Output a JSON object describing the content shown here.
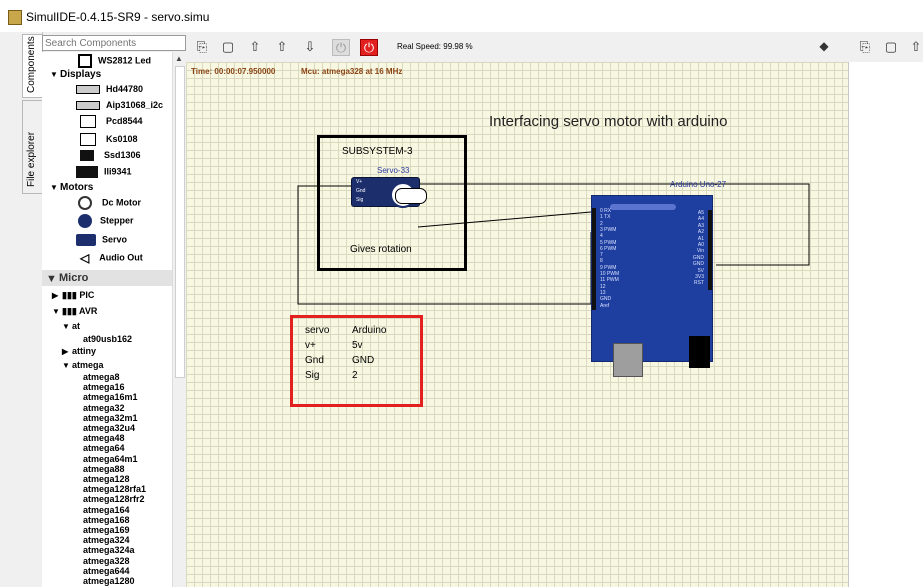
{
  "window": {
    "title": "SimulIDE-0.4.15-SR9  -  servo.simu"
  },
  "side_tabs": [
    "Components",
    "File explorer"
  ],
  "search": {
    "placeholder": "Search Components"
  },
  "tree": {
    "top_item": "WS2812 Led",
    "displays": {
      "label": "Displays",
      "items": [
        "Hd44780",
        "Aip31068_i2c",
        "Pcd8544",
        "Ks0108",
        "Ssd1306",
        "Ili9341"
      ]
    },
    "motors": {
      "label": "Motors",
      "items": [
        "Dc Motor",
        "Stepper",
        "Servo",
        "Audio Out"
      ]
    },
    "micro": {
      "label": "Micro",
      "pic": "PIC",
      "avr": "AVR",
      "at": "at",
      "at90": "at90usb162",
      "attiny": "attiny",
      "atmega": "atmega",
      "chips": [
        "atmega8",
        "atmega16",
        "atmega16m1",
        "atmega32",
        "atmega32m1",
        "atmega32u4",
        "atmega48",
        "atmega64",
        "atmega64m1",
        "atmega88",
        "atmega128",
        "atmega128rfa1",
        "atmega128rfr2",
        "atmega164",
        "atmega168",
        "atmega169",
        "atmega324",
        "atmega324a",
        "atmega328",
        "atmega644",
        "atmega1280"
      ]
    }
  },
  "toolbar": {
    "real_speed": "Real Speed: 99.98 %",
    "icons": [
      "new-circuit-icon",
      "new-file-icon",
      "open-icon",
      "save-icon",
      "save-as-icon",
      "power-off-icon",
      "power-on-icon"
    ]
  },
  "status": {
    "time": "Time: 00:00:07.950000",
    "mcu": "Mcu: atmega328 at 16 MHz"
  },
  "diagram": {
    "heading": "Interfacing  servo motor with arduino",
    "subsystem": "SUBSYSTEM-3",
    "servo_label": "Servo-33",
    "rotation": "Gives rotation",
    "arduino_label": "Arduino Uno-27",
    "servo_pins": [
      "V+",
      "Gnd",
      "Sig"
    ],
    "arduino_left_pins": [
      "0 RX",
      "1 TX",
      "2",
      "3 PWM",
      "4",
      "5 PWM",
      "6 PWM",
      "7",
      "8",
      "9 PWM",
      "10 PWM",
      "11 PWM",
      "12",
      "13",
      "GND",
      "Aref"
    ],
    "arduino_right_pins": [
      "A5",
      "A4",
      "A3",
      "A2",
      "A1",
      "A0",
      "Vin",
      "GND",
      "GND",
      "5V",
      "3V3",
      "RST"
    ],
    "table": {
      "headers": [
        "servo",
        "Arduino"
      ],
      "rows": [
        [
          "v+",
          "5v"
        ],
        [
          "Gnd",
          "GND"
        ],
        [
          "Sig",
          "2"
        ]
      ]
    }
  },
  "colors": {
    "canvas": "#f7f7e2",
    "board": "#1e3ea0",
    "highlight": "#e32020"
  }
}
